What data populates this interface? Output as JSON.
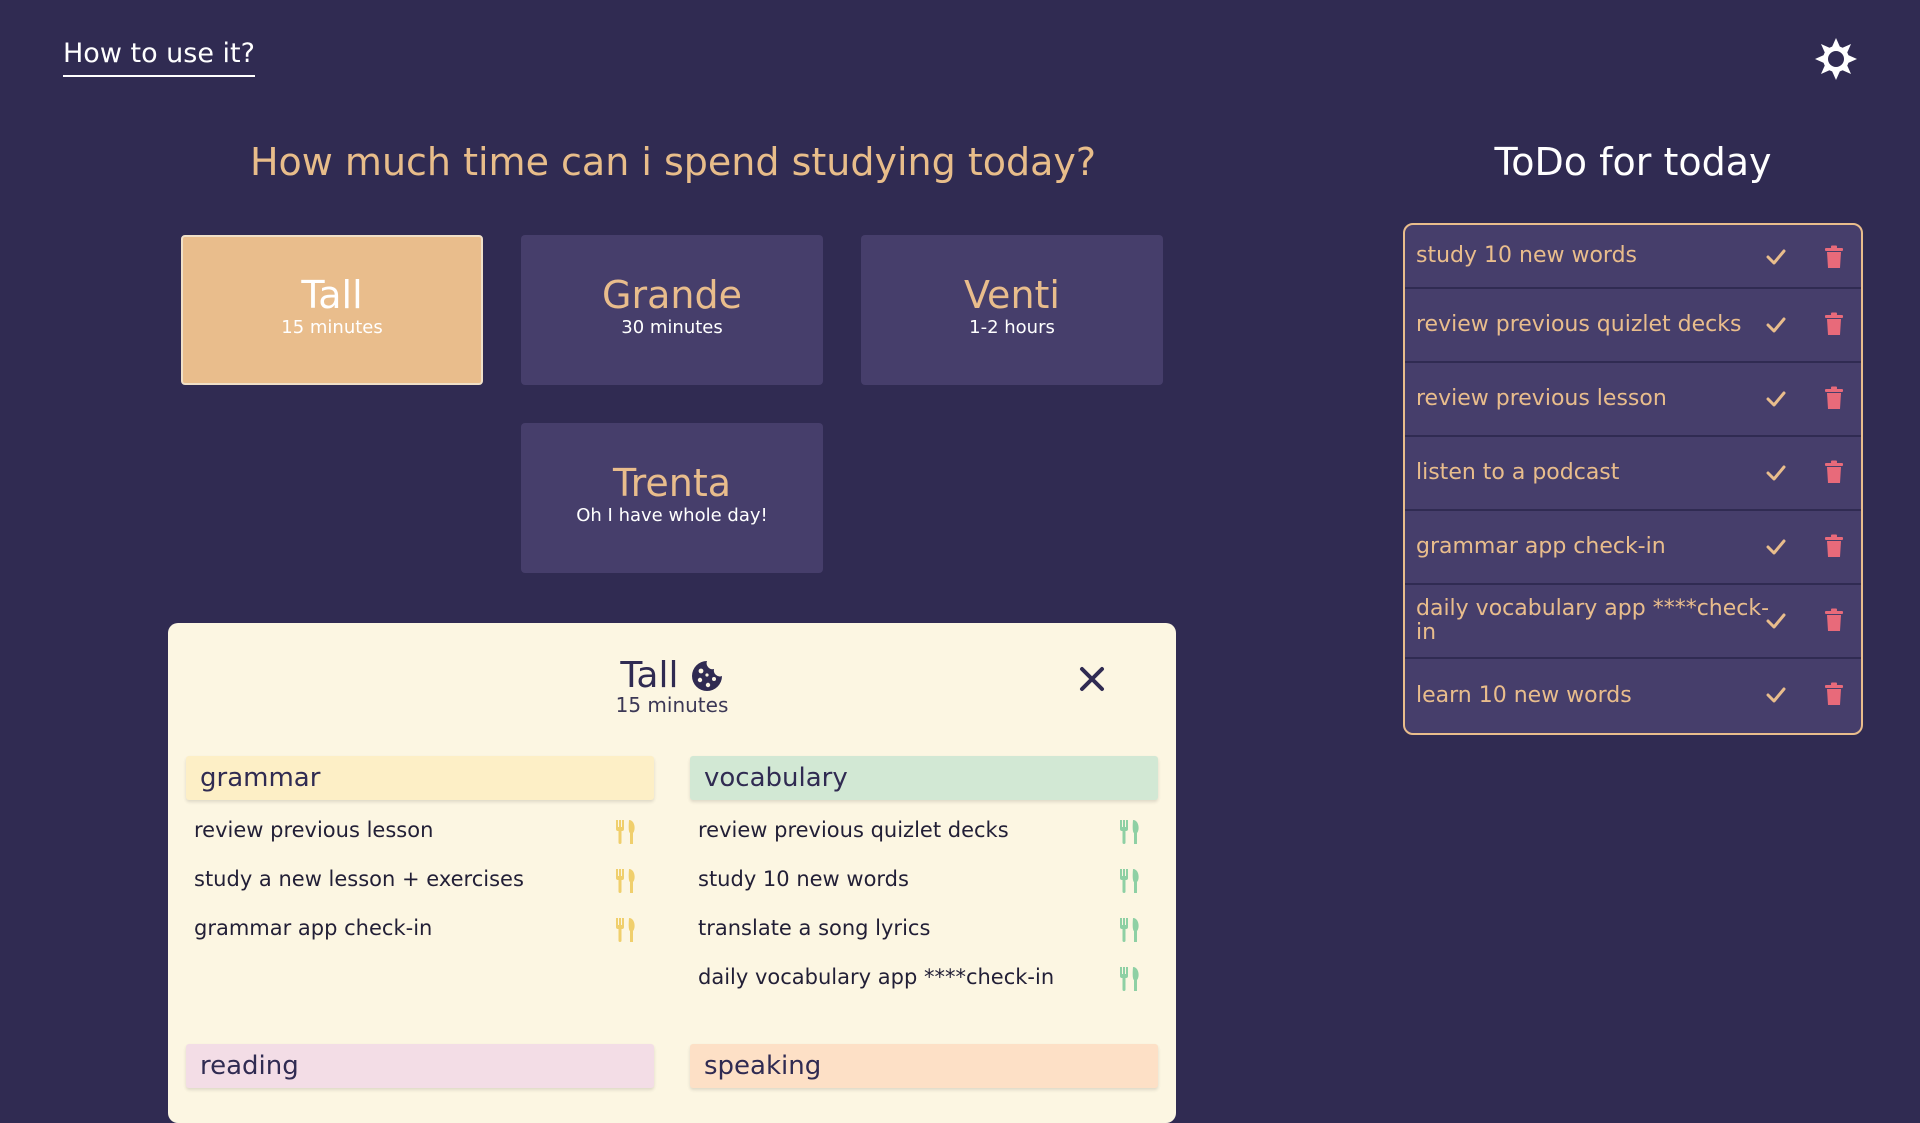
{
  "header": {
    "help_link": "How to use it?",
    "theme_icon": "sun-icon"
  },
  "question": "How much time can i spend studying today?",
  "sizes": [
    {
      "name": "Tall",
      "sub": "15 minutes",
      "active": true
    },
    {
      "name": "Grande",
      "sub": "30 minutes",
      "active": false
    },
    {
      "name": "Venti",
      "sub": "1-2 hours",
      "active": false
    },
    {
      "name": "Trenta",
      "sub": "Oh I have whole day!",
      "active": false
    }
  ],
  "panel": {
    "title": "Tall",
    "title_icon": "cookie-icon",
    "subtitle": "15 minutes",
    "close_icon": "close-icon",
    "categories": [
      {
        "name": "grammar",
        "color": "#fdefc6",
        "icon_color": "#f0cf6c",
        "items": [
          "review previous lesson",
          "study a new lesson + exercises",
          "grammar app check-in"
        ]
      },
      {
        "name": "vocabulary",
        "color": "#d2e8d4",
        "icon_color": "#8ed0a4",
        "items": [
          "review previous quizlet decks",
          "study 10 new words",
          "translate a song lyrics",
          "daily vocabulary app ****check-in"
        ]
      },
      {
        "name": "reading",
        "color": "#f3dde6",
        "icon_color": "#e3a8c0",
        "items": []
      },
      {
        "name": "speaking",
        "color": "#fde0c6",
        "icon_color": "#f0b07c",
        "items": []
      }
    ]
  },
  "todo": {
    "title": "ToDo for today",
    "items": [
      "study 10 new words",
      "review previous quizlet decks",
      "review previous lesson",
      "listen to a podcast",
      "grammar app check-in",
      "daily vocabulary app ****check-in",
      "learn 10 new words"
    ],
    "check_color": "#e9bd8c",
    "trash_color": "#e86a7a"
  },
  "colors": {
    "background": "#302b52",
    "card": "#463e6b",
    "accent": "#e9bd8c",
    "panel": "#fcf6e2"
  }
}
